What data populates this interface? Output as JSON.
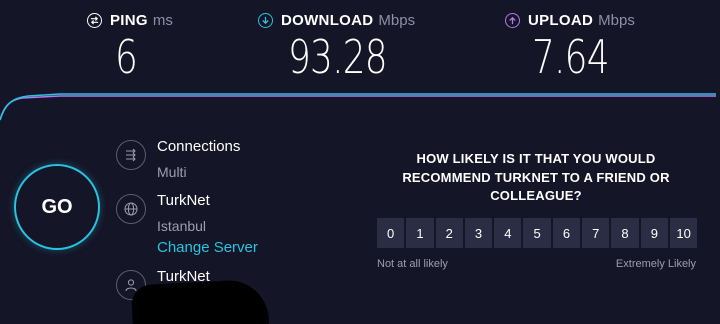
{
  "metrics": {
    "ping": {
      "label": "PING",
      "unit": "ms",
      "value": "6",
      "color": "#ffffff"
    },
    "download": {
      "label": "DOWNLOAD",
      "unit": "Mbps",
      "value": "93.28",
      "color": "#27c3e0"
    },
    "upload": {
      "label": "UPLOAD",
      "unit": "Mbps",
      "value": "7.64",
      "color": "#b07cf0"
    }
  },
  "go_button": {
    "label": "GO",
    "color": "#27c3e0"
  },
  "connections": {
    "title": "Connections",
    "value": "Multi",
    "icon": "connections-icon"
  },
  "server": {
    "title": "TurkNet",
    "location": "Istanbul",
    "change_label": "Change Server",
    "icon": "globe-icon"
  },
  "isp": {
    "title": "TurkNet",
    "icon": "user-icon"
  },
  "survey": {
    "question": "HOW LIKELY IS IT THAT YOU WOULD RECOMMEND TURKNET TO A FRIEND OR COLLEAGUE?",
    "scale": [
      "0",
      "1",
      "2",
      "3",
      "4",
      "5",
      "6",
      "7",
      "8",
      "9",
      "10"
    ],
    "low_label": "Not at all likely",
    "high_label": "Extremely Likely"
  },
  "colors": {
    "background": "#141526",
    "accent": "#27c3e0",
    "upload": "#b07cf0",
    "muted": "#9c9eb2"
  }
}
